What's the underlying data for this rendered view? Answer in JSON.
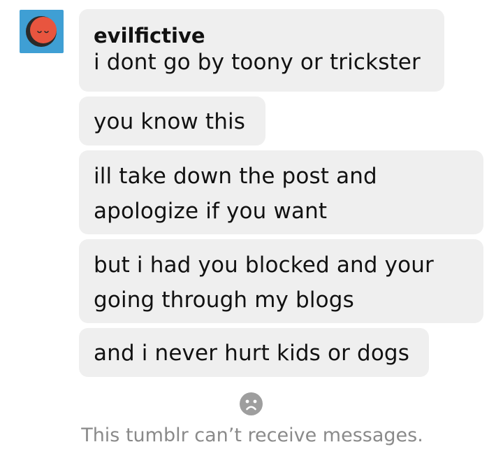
{
  "conversation": {
    "sender": {
      "username": "evilfictive",
      "avatar_icon": "sleepy-face-avatar-icon",
      "avatar_background": "#3f9fd4",
      "avatar_face_color": "#e8553f"
    },
    "messages": [
      {
        "text": "i dont go by toony or trickster"
      },
      {
        "text": "you know this"
      },
      {
        "lines": [
          "ill take down the post and",
          "apologize if you want"
        ]
      },
      {
        "lines": [
          "but i had you blocked and your",
          "going through my blogs"
        ]
      },
      {
        "text": "and i never hurt kids or dogs"
      }
    ]
  },
  "footer": {
    "icon": "sad-face-icon",
    "status_text": "This tumblr can’t receive messages."
  },
  "colors": {
    "bubble_background": "#efefef",
    "status_text": "#8a8a8a",
    "icon_gray": "#9e9e9e"
  }
}
